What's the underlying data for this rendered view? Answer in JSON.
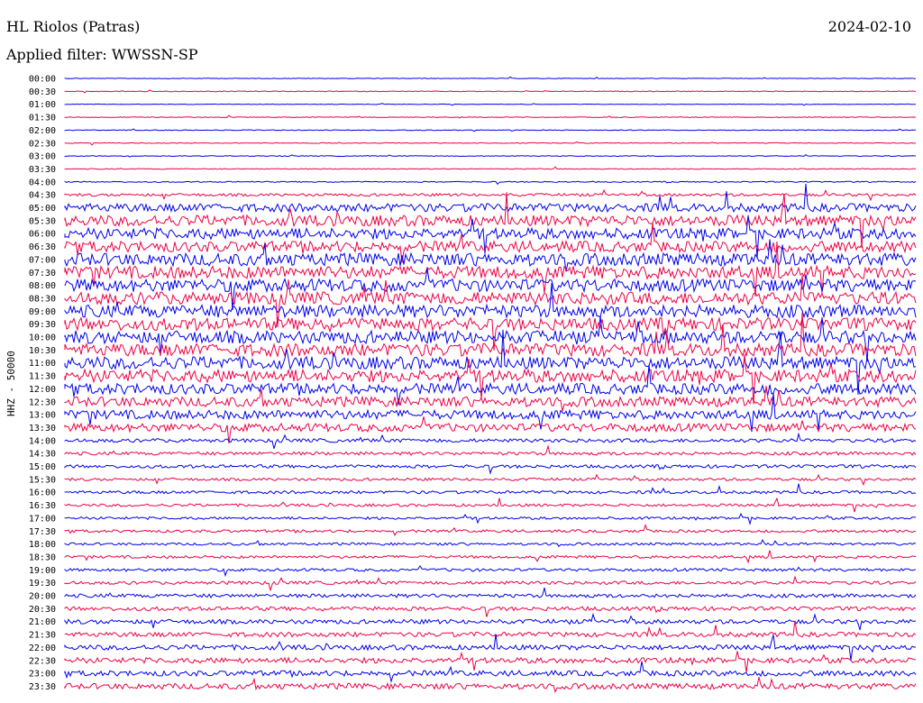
{
  "header": {
    "station": "HL Riolos (Patras)",
    "date": "2024-02-10",
    "filter": "Applied filter: WWSSN-SP"
  },
  "chart_data": {
    "type": "line",
    "title": "HL Riolos (Patras)",
    "ylabel": "HHZ - 50000",
    "colors": [
      "#0000ee",
      "#ee0044"
    ],
    "row_labels": [
      "00:00",
      "00:30",
      "01:00",
      "01:30",
      "02:00",
      "02:30",
      "03:00",
      "03:30",
      "04:00",
      "04:30",
      "05:00",
      "05:30",
      "06:00",
      "06:30",
      "07:00",
      "07:30",
      "08:00",
      "08:30",
      "09:00",
      "09:30",
      "10:00",
      "10:30",
      "11:00",
      "11:30",
      "12:00",
      "12:30",
      "13:00",
      "13:30",
      "14:00",
      "14:30",
      "15:00",
      "15:30",
      "16:00",
      "16:30",
      "17:00",
      "17:30",
      "18:00",
      "18:30",
      "19:00",
      "19:30",
      "20:00",
      "20:30",
      "21:00",
      "21:30",
      "22:00",
      "22:30",
      "23:00",
      "23:30"
    ],
    "noise_level": [
      0.3,
      0.4,
      0.3,
      0.4,
      0.4,
      0.4,
      0.4,
      0.5,
      0.6,
      1.5,
      4.5,
      6,
      6,
      6,
      7,
      7,
      7,
      7,
      7,
      7,
      7,
      7,
      7,
      7,
      6,
      5.5,
      5,
      4.5,
      2,
      1.8,
      1.8,
      1.5,
      1.6,
      1.5,
      1.4,
      1.5,
      1.4,
      1.5,
      1.6,
      1.8,
      2,
      2.2,
      2.4,
      2.6,
      2.8,
      3,
      3,
      3.2
    ]
  }
}
